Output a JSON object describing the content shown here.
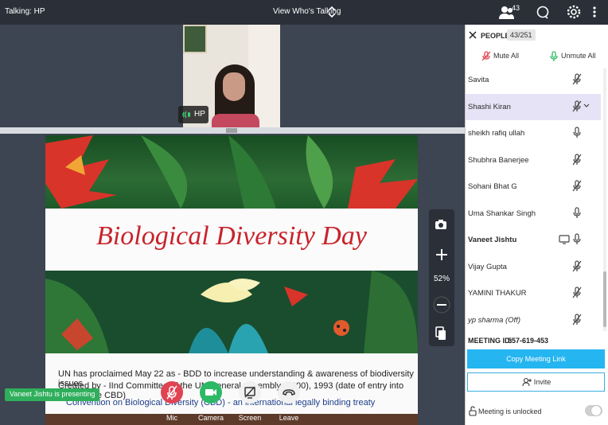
{
  "topbar": {
    "talking": "Talking: HP",
    "view_label": "View Who's Talking",
    "people_count": "43"
  },
  "video": {
    "participant_label": "HP"
  },
  "slide": {
    "title": "Biological Diversity Day",
    "line1": "UN has proclaimed May 22 as - BDD to increase understanding & awareness of biodiversity issues",
    "line2": "Created by - IInd Committee of the UN General Assembly (2000), 1993 (date of entry into force of the CBD)",
    "line3": "Convention on Biological Diversity (CBD) - an international legally binding treaty"
  },
  "zoom": {
    "level": "52%"
  },
  "presenting": "Vaneet Jishtu is presenting",
  "controls": {
    "mic": "Mic",
    "camera": "Camera",
    "screen": "Screen",
    "leave": "Leave"
  },
  "panel": {
    "title": "PEOPLE",
    "badge": "43/251",
    "mute_all": "Mute All",
    "unmute_all": "Unmute All",
    "participants": [
      {
        "name": "Savita",
        "mic": "muted"
      },
      {
        "name": "Shashi Kiran",
        "mic": "muted",
        "selected": true
      },
      {
        "name": "sheikh rafiq ullah",
        "mic": "on"
      },
      {
        "name": "Shubhra Banerjee",
        "mic": "muted"
      },
      {
        "name": "Sohani Bhat G",
        "mic": "muted"
      },
      {
        "name": "Uma Shankar Singh",
        "mic": "on"
      },
      {
        "name": "Vaneet Jishtu",
        "mic": "on",
        "presenter": true
      },
      {
        "name": "Vijay Gupta",
        "mic": "muted"
      },
      {
        "name": "YAMINI THAKUR",
        "mic": "muted"
      },
      {
        "name": "yp sharma  (Off)",
        "mic": "muted"
      }
    ],
    "meeting_id_label": "MEETING ID:",
    "meeting_id": "557-619-453",
    "copy_link": "Copy Meeting Link",
    "invite": "Invite",
    "lock_status": "Meeting is unlocked"
  },
  "colors": {
    "accent": "#25b5f0",
    "mic_off": "#e04352",
    "camera_on": "#2cb865",
    "presenting": "#2fae5b"
  }
}
